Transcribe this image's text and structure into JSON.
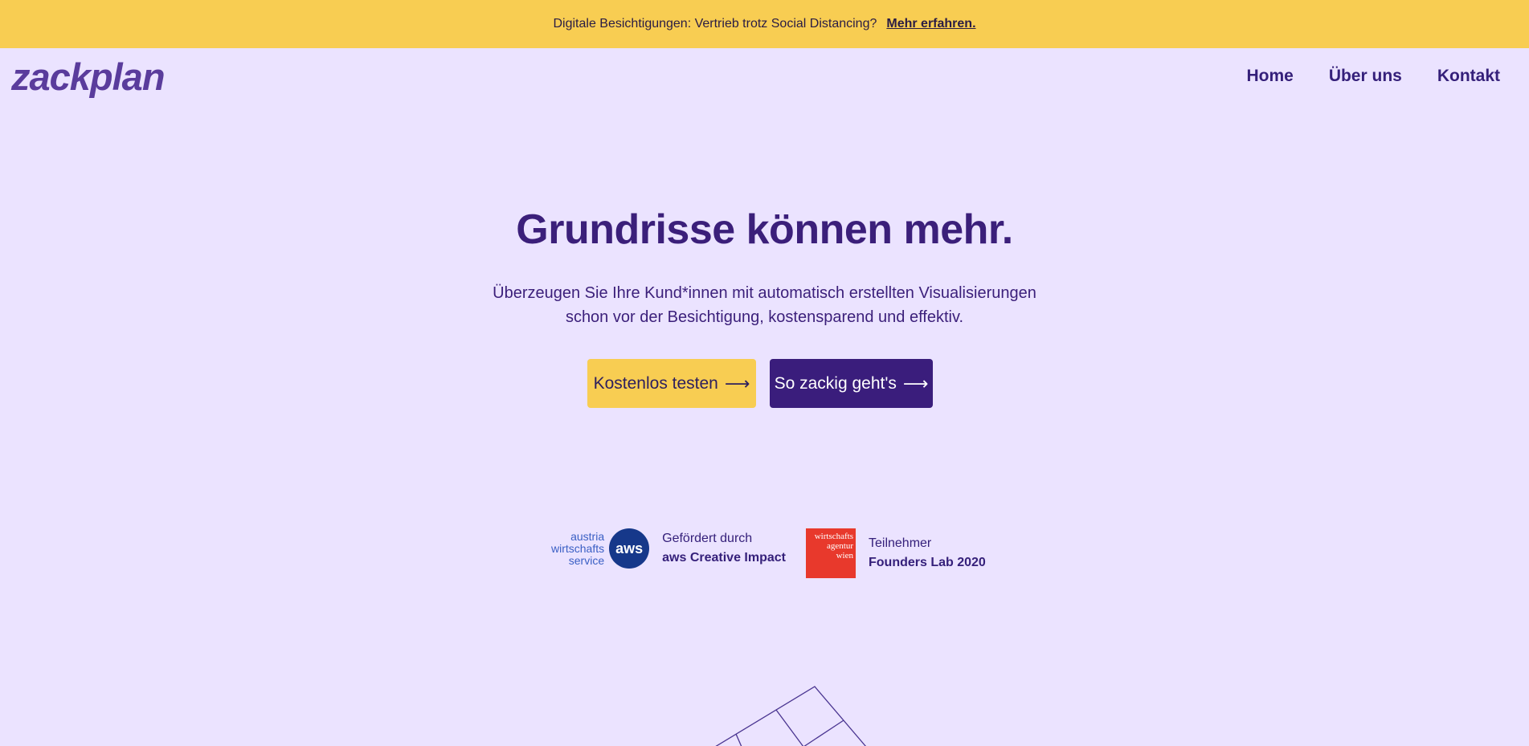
{
  "banner": {
    "text": "Digitale Besichtigungen: Vertrieb trotz Social Distancing?",
    "link": "Mehr erfahren."
  },
  "logo": "zackplan",
  "nav": [
    "Home",
    "Über uns",
    "Kontakt"
  ],
  "hero": {
    "title": "Grundrisse können mehr.",
    "subtitle_line1": "Überzeugen Sie Ihre Kund*innen mit automatisch erstellten Visualisierungen",
    "subtitle_line2": "schon vor der Besichtigung, kostensparend und effektiv.",
    "btn_primary": "Kostenlos testen",
    "btn_secondary": "So zackig geht's",
    "arrow": "⟶"
  },
  "sponsors": {
    "aws": {
      "logo_line1": "austria",
      "logo_line2": "wirtschafts",
      "logo_line3": "service",
      "badge": "aws",
      "caption_line1": "Gefördert durch",
      "caption_line2": "aws Creative Impact"
    },
    "wien": {
      "logo_line1": "wirtschafts",
      "logo_line2": "agentur",
      "logo_line3": "wien",
      "caption_line1": "Teilnehmer",
      "caption_line2": "Founders Lab 2020"
    }
  },
  "colors": {
    "background": "#ebe3ff",
    "banner": "#f8cd52",
    "primary_purple": "#3a1d7c",
    "aws_blue": "#16388a",
    "wien_red": "#e8392c"
  }
}
